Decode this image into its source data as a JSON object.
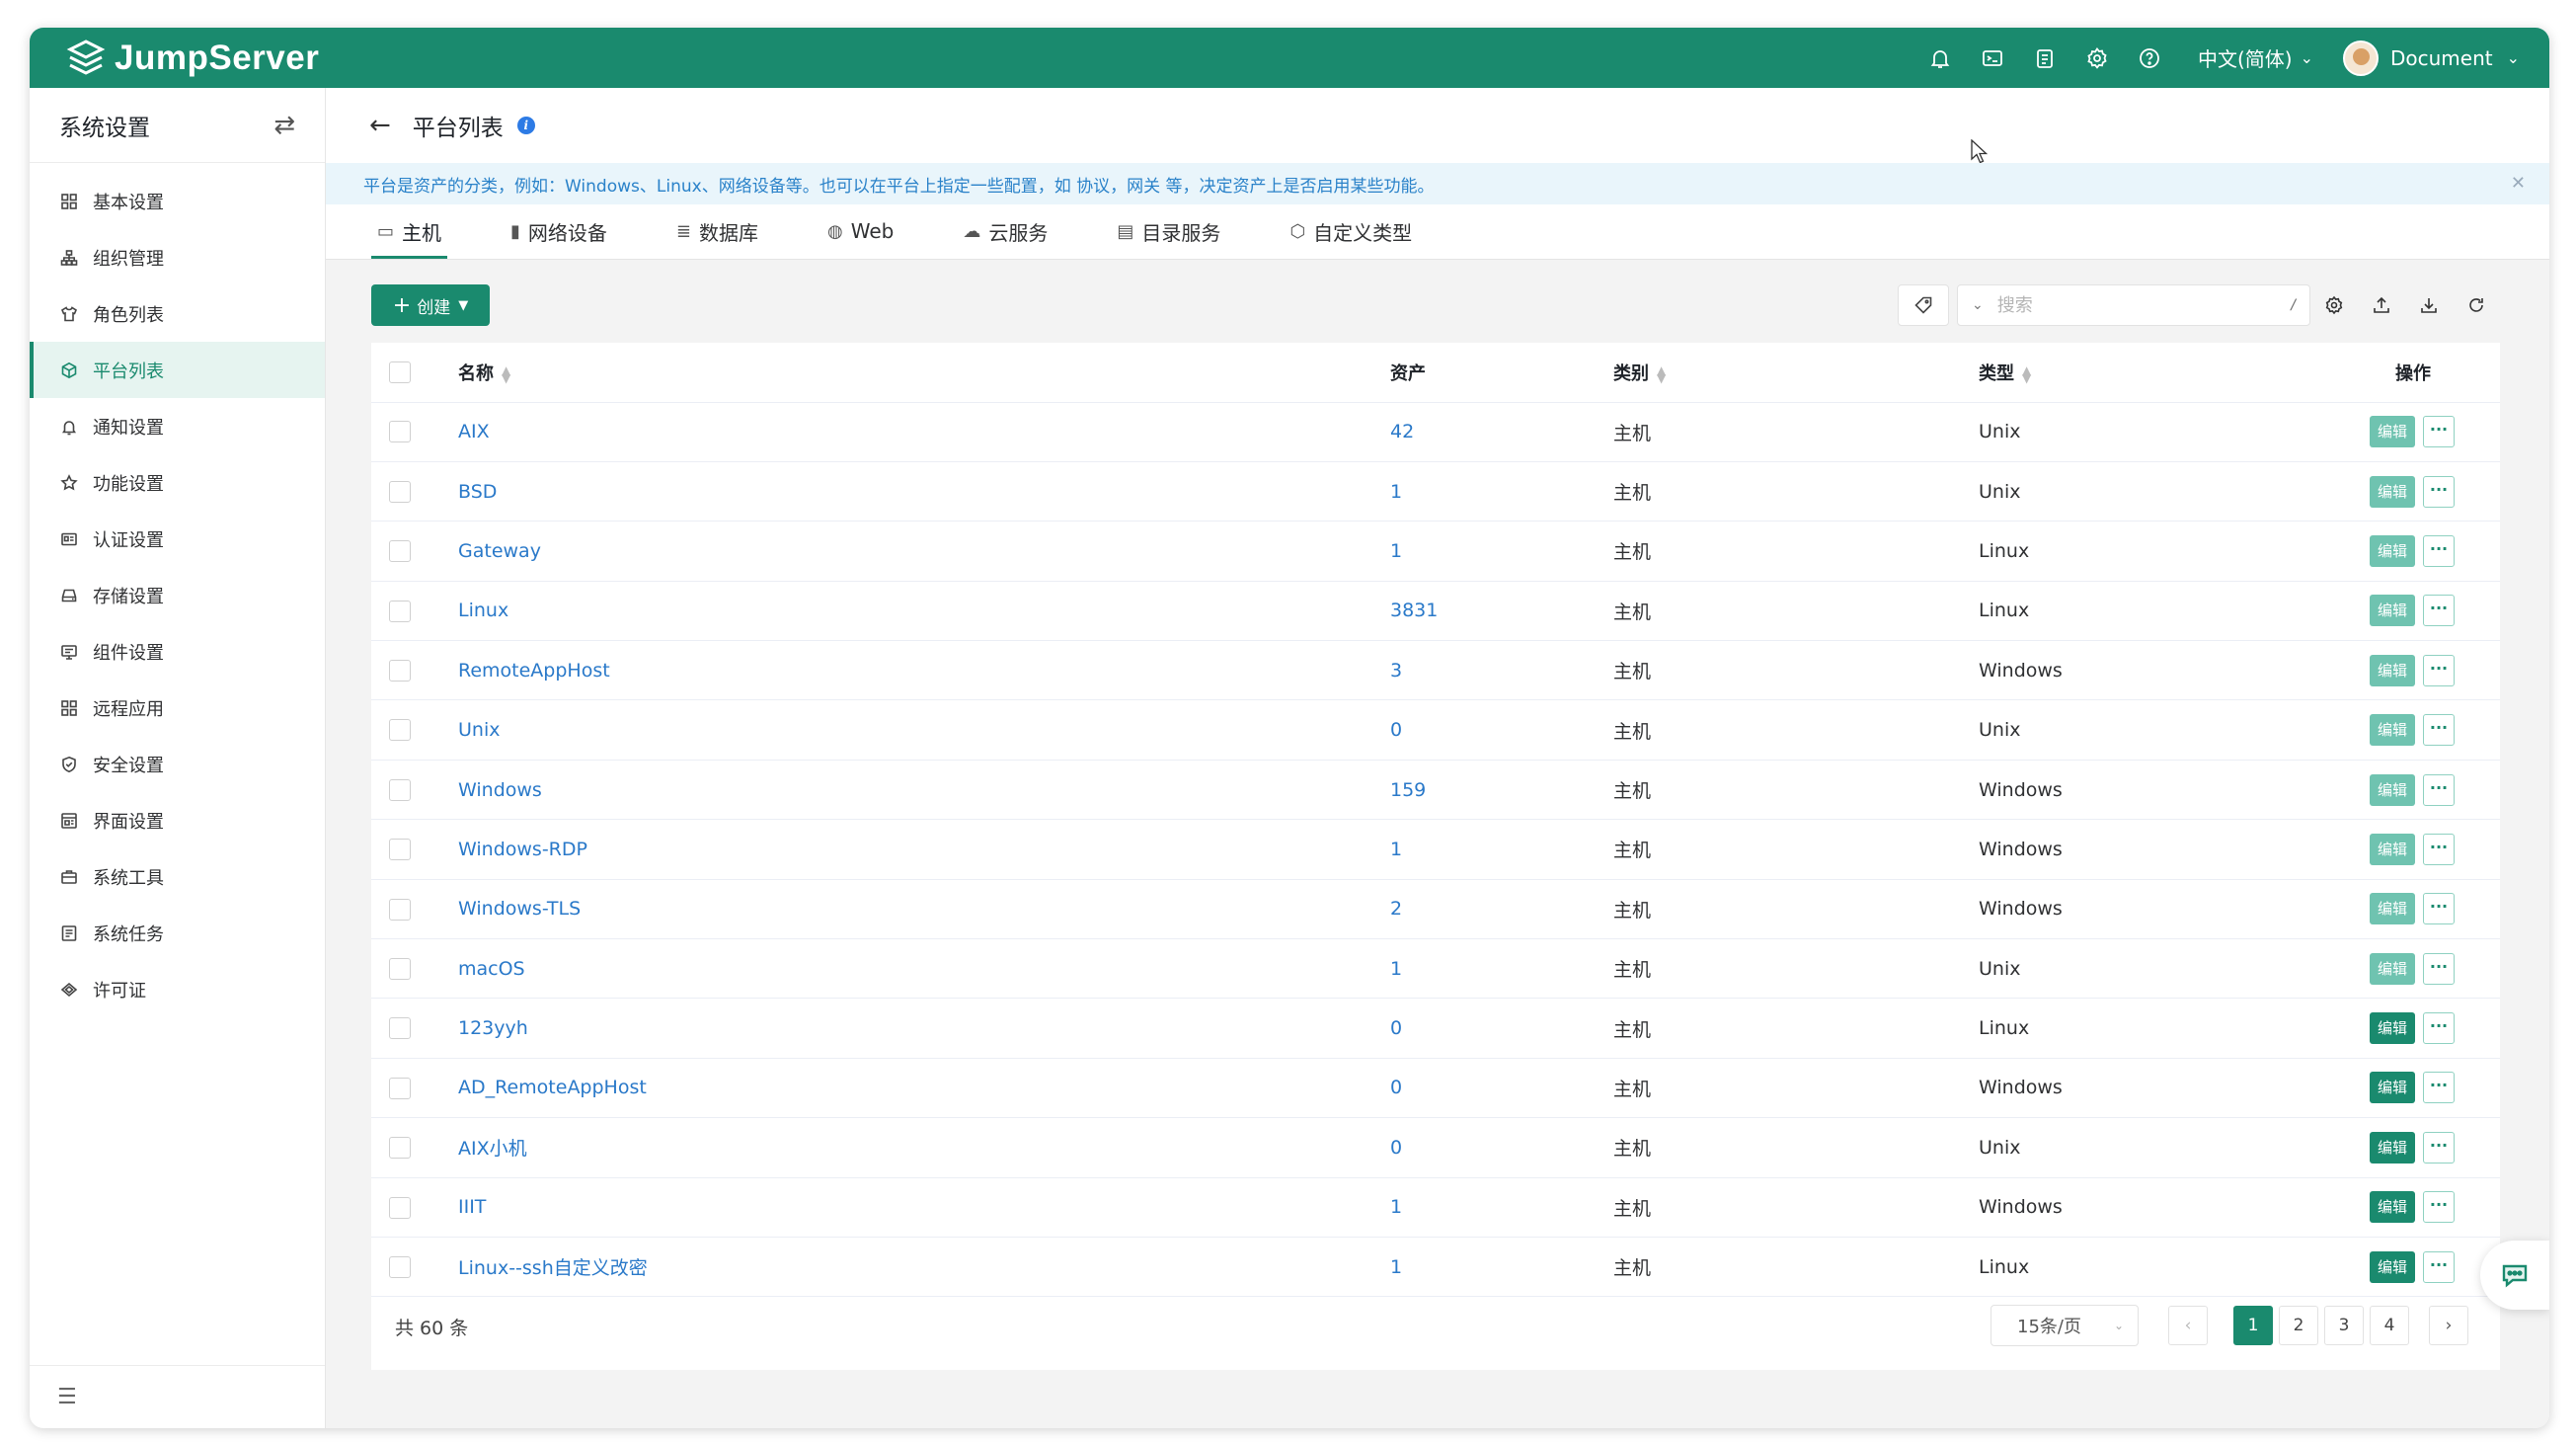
{
  "app": {
    "name": "JumpServer"
  },
  "header": {
    "icons": [
      "bell-icon",
      "terminal-icon",
      "clipboard-icon",
      "gear-icon",
      "help-icon"
    ],
    "language": "中文(简体)",
    "user": "Document"
  },
  "sidebar": {
    "title": "系统设置",
    "items": [
      {
        "label": "基本设置",
        "icon": "grid-icon"
      },
      {
        "label": "组织管理",
        "icon": "org-icon"
      },
      {
        "label": "角色列表",
        "icon": "shirt-icon"
      },
      {
        "label": "平台列表",
        "icon": "cube-icon"
      },
      {
        "label": "通知设置",
        "icon": "bell-icon"
      },
      {
        "label": "功能设置",
        "icon": "star-icon"
      },
      {
        "label": "认证设置",
        "icon": "id-card-icon"
      },
      {
        "label": "存储设置",
        "icon": "storage-icon"
      },
      {
        "label": "组件设置",
        "icon": "component-icon"
      },
      {
        "label": "远程应用",
        "icon": "apps-icon"
      },
      {
        "label": "安全设置",
        "icon": "shield-icon"
      },
      {
        "label": "界面设置",
        "icon": "interface-icon"
      },
      {
        "label": "系统工具",
        "icon": "toolbox-icon"
      },
      {
        "label": "系统任务",
        "icon": "tasks-icon"
      },
      {
        "label": "许可证",
        "icon": "license-icon"
      }
    ],
    "active_index": 3
  },
  "page": {
    "title": "平台列表",
    "notice": "平台是资产的分类，例如：Windows、Linux、网络设备等。也可以在平台上指定一些配置，如 协议，网关 等，决定资产上是否启用某些功能。"
  },
  "tabs": [
    {
      "label": "主机",
      "icon": "host-icon"
    },
    {
      "label": "网络设备",
      "icon": "device-icon"
    },
    {
      "label": "数据库",
      "icon": "database-icon"
    },
    {
      "label": "Web",
      "icon": "globe-icon"
    },
    {
      "label": "云服务",
      "icon": "cloud-icon"
    },
    {
      "label": "目录服务",
      "icon": "directory-icon"
    },
    {
      "label": "自定义类型",
      "icon": "custom-icon"
    }
  ],
  "toolbar": {
    "create_label": "创建",
    "search_placeholder": "搜索",
    "search_shortcut": "/"
  },
  "table": {
    "columns": {
      "name": "名称",
      "assets": "资产",
      "category": "类别",
      "type": "类型",
      "actions": "操作"
    },
    "edit_label": "编辑",
    "more_label": "···",
    "rows": [
      {
        "name": "AIX",
        "assets": "42",
        "category": "主机",
        "type": "Unix",
        "builtin": true
      },
      {
        "name": "BSD",
        "assets": "1",
        "category": "主机",
        "type": "Unix",
        "builtin": true
      },
      {
        "name": "Gateway",
        "assets": "1",
        "category": "主机",
        "type": "Linux",
        "builtin": true
      },
      {
        "name": "Linux",
        "assets": "3831",
        "category": "主机",
        "type": "Linux",
        "builtin": true
      },
      {
        "name": "RemoteAppHost",
        "assets": "3",
        "category": "主机",
        "type": "Windows",
        "builtin": true
      },
      {
        "name": "Unix",
        "assets": "0",
        "category": "主机",
        "type": "Unix",
        "builtin": true
      },
      {
        "name": "Windows",
        "assets": "159",
        "category": "主机",
        "type": "Windows",
        "builtin": true
      },
      {
        "name": "Windows-RDP",
        "assets": "1",
        "category": "主机",
        "type": "Windows",
        "builtin": true
      },
      {
        "name": "Windows-TLS",
        "assets": "2",
        "category": "主机",
        "type": "Windows",
        "builtin": true
      },
      {
        "name": "macOS",
        "assets": "1",
        "category": "主机",
        "type": "Unix",
        "builtin": true
      },
      {
        "name": "123yyh",
        "assets": "0",
        "category": "主机",
        "type": "Linux",
        "builtin": false
      },
      {
        "name": "AD_RemoteAppHost",
        "assets": "0",
        "category": "主机",
        "type": "Windows",
        "builtin": false
      },
      {
        "name": "AIX小机",
        "assets": "0",
        "category": "主机",
        "type": "Unix",
        "builtin": false
      },
      {
        "name": "IIIT",
        "assets": "1",
        "category": "主机",
        "type": "Windows",
        "builtin": false
      },
      {
        "name": "Linux--ssh自定义改密",
        "assets": "1",
        "category": "主机",
        "type": "Linux",
        "builtin": false
      }
    ]
  },
  "footer": {
    "total": "共 60 条",
    "page_size": "15条/页",
    "pages": [
      "1",
      "2",
      "3",
      "4"
    ],
    "current_page": "1"
  },
  "colors": {
    "brand": "#1a8a6e",
    "link": "#2a79c9",
    "notice_bg": "#e9f5fb"
  }
}
